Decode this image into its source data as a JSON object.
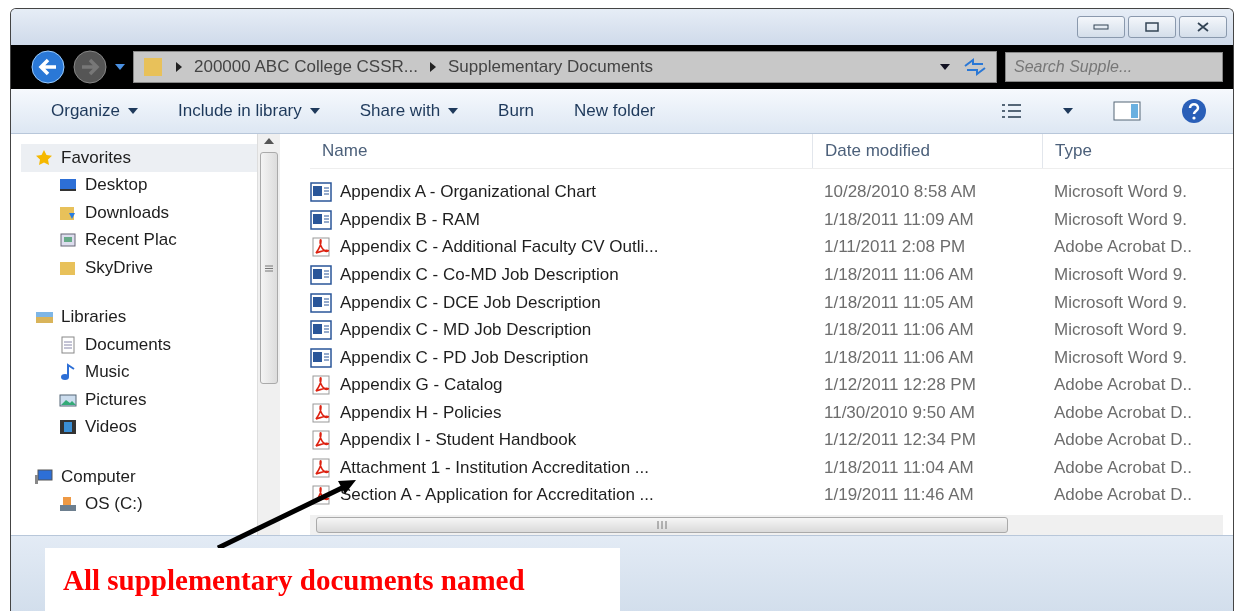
{
  "address_bar": {
    "segments": [
      "200000 ABC College CSSR...",
      "Supplementary Documents"
    ],
    "search_placeholder": "Search Supple..."
  },
  "toolbar": {
    "menus": [
      {
        "label": "Organize",
        "dropdown": true
      },
      {
        "label": "Include in library",
        "dropdown": true
      },
      {
        "label": "Share with",
        "dropdown": true
      },
      {
        "label": "Burn",
        "dropdown": false
      },
      {
        "label": "New folder",
        "dropdown": false
      }
    ]
  },
  "navigation": [
    {
      "label": "Favorites",
      "selected": true,
      "children": [
        {
          "label": "Desktop"
        },
        {
          "label": "Downloads"
        },
        {
          "label": "Recent Plac"
        },
        {
          "label": "SkyDrive"
        }
      ]
    },
    {
      "label": "Libraries",
      "selected": false,
      "children": [
        {
          "label": "Documents"
        },
        {
          "label": "Music"
        },
        {
          "label": "Pictures"
        },
        {
          "label": "Videos"
        }
      ]
    },
    {
      "label": "Computer",
      "selected": false,
      "children": [
        {
          "label": "OS (C:)"
        }
      ]
    }
  ],
  "table": {
    "columns": [
      "Name",
      "Date modified",
      "Type"
    ],
    "rows": [
      {
        "kind": "word",
        "name": "Appendix A - Organizational Chart",
        "date": "10/28/2010 8:58 AM",
        "type": "Microsoft Word 9."
      },
      {
        "kind": "word",
        "name": "Appendix B - RAM",
        "date": "1/18/2011 11:09 AM",
        "type": "Microsoft Word 9."
      },
      {
        "kind": "pdf",
        "name": "Appendix C - Additional Faculty CV Outli...",
        "date": "1/11/2011 2:08 PM",
        "type": "Adobe Acrobat D.."
      },
      {
        "kind": "word",
        "name": "Appendix C - Co-MD Job Description",
        "date": "1/18/2011 11:06 AM",
        "type": "Microsoft Word 9."
      },
      {
        "kind": "word",
        "name": "Appendix C - DCE Job Description",
        "date": "1/18/2011 11:05 AM",
        "type": "Microsoft Word 9."
      },
      {
        "kind": "word",
        "name": "Appendix C - MD Job Description",
        "date": "1/18/2011 11:06 AM",
        "type": "Microsoft Word 9."
      },
      {
        "kind": "word",
        "name": "Appendix C - PD Job Description",
        "date": "1/18/2011 11:06 AM",
        "type": "Microsoft Word 9."
      },
      {
        "kind": "pdf",
        "name": "Appendix G - Catalog",
        "date": "1/12/2011 12:28 PM",
        "type": "Adobe Acrobat D.."
      },
      {
        "kind": "pdf",
        "name": "Appendix H - Policies",
        "date": "11/30/2010 9:50 AM",
        "type": "Adobe Acrobat D.."
      },
      {
        "kind": "pdf",
        "name": "Appendix I - Student Handbook",
        "date": "1/12/2011 12:34 PM",
        "type": "Adobe Acrobat D.."
      },
      {
        "kind": "pdf",
        "name": "Attachment 1 - Institution Accreditation ...",
        "date": "1/18/2011 11:04 AM",
        "type": "Adobe Acrobat D.."
      },
      {
        "kind": "pdf",
        "name": "Section A - Application for Accreditation ...",
        "date": "1/19/2011 11:46 AM",
        "type": "Adobe Acrobat D.."
      }
    ]
  },
  "callout": {
    "text": "All supplementary documents named"
  }
}
